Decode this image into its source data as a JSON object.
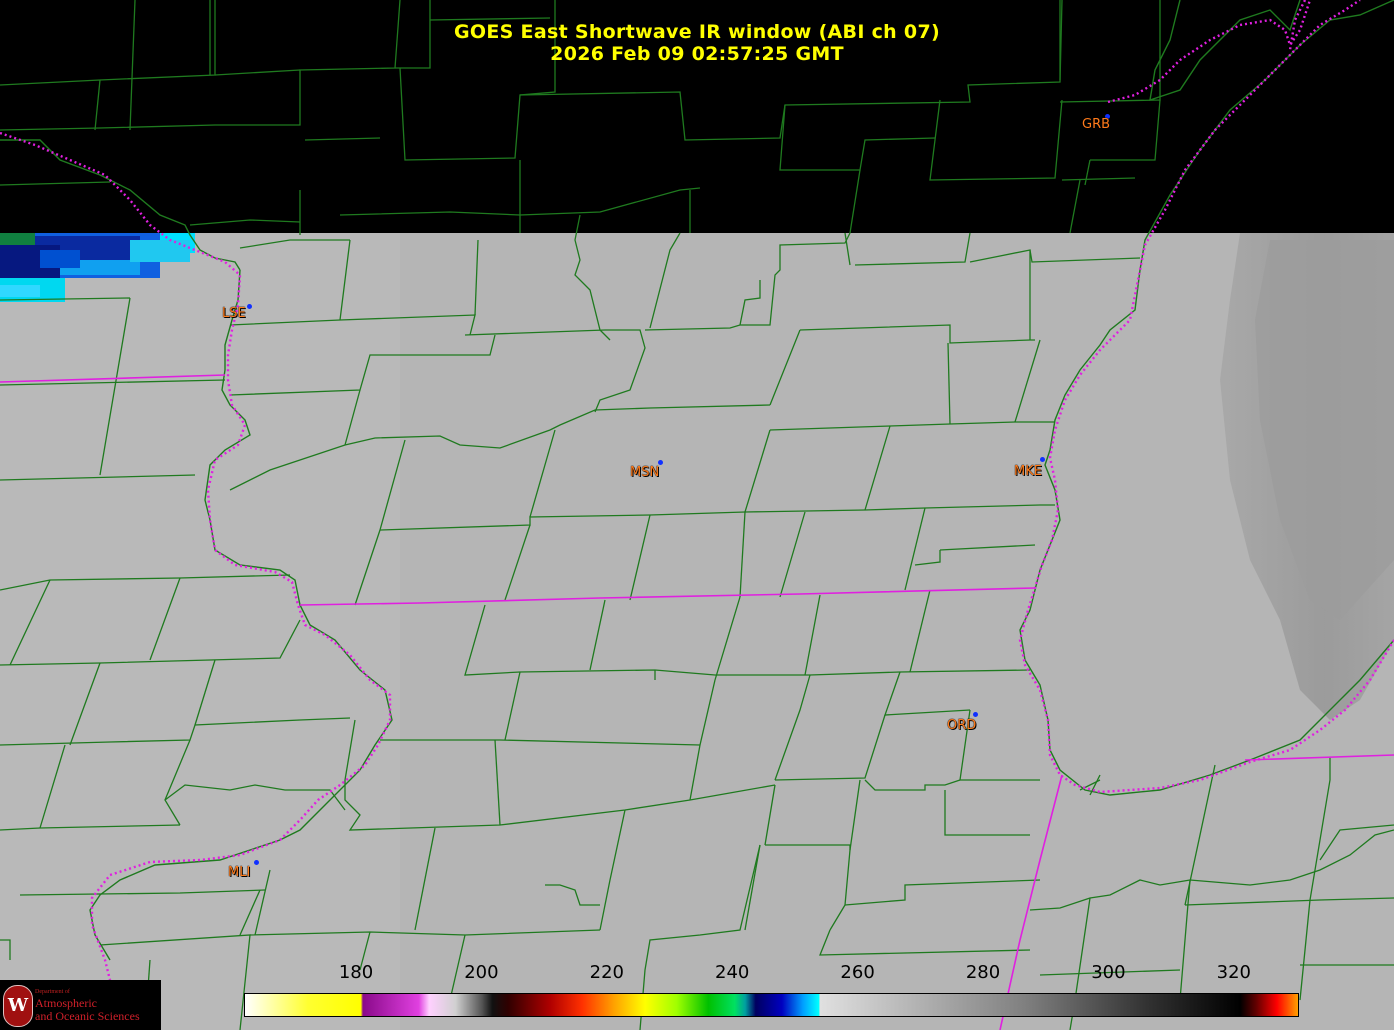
{
  "title": {
    "line1": "GOES East Shortwave IR window (ABI ch 07)",
    "line2": "2026 Feb 09  02:57:25 GMT"
  },
  "stations": [
    {
      "id": "GRB",
      "name": "station-label-grb"
    },
    {
      "id": "LSE",
      "name": "station-label-lse"
    },
    {
      "id": "MSN",
      "name": "station-label-msn"
    },
    {
      "id": "MKE",
      "name": "station-label-mke"
    },
    {
      "id": "ORD",
      "name": "station-label-ord"
    },
    {
      "id": "MLI",
      "name": "station-label-mli"
    }
  ],
  "colorbar": {
    "ticks": [
      "180",
      "200",
      "220",
      "240",
      "260",
      "280",
      "300",
      "320"
    ]
  },
  "logo": {
    "line1": "Department of",
    "line2": "Atmospheric",
    "line3": "and Oceanic Sciences",
    "seal": "W"
  },
  "colors": {
    "title": "#ffff00",
    "station_label": "#ff7a1a",
    "county_lines": "#1f7a1f",
    "state_lines": "#e020e0",
    "cloud_background": "#b5b5b5",
    "no_data": "#000000"
  }
}
